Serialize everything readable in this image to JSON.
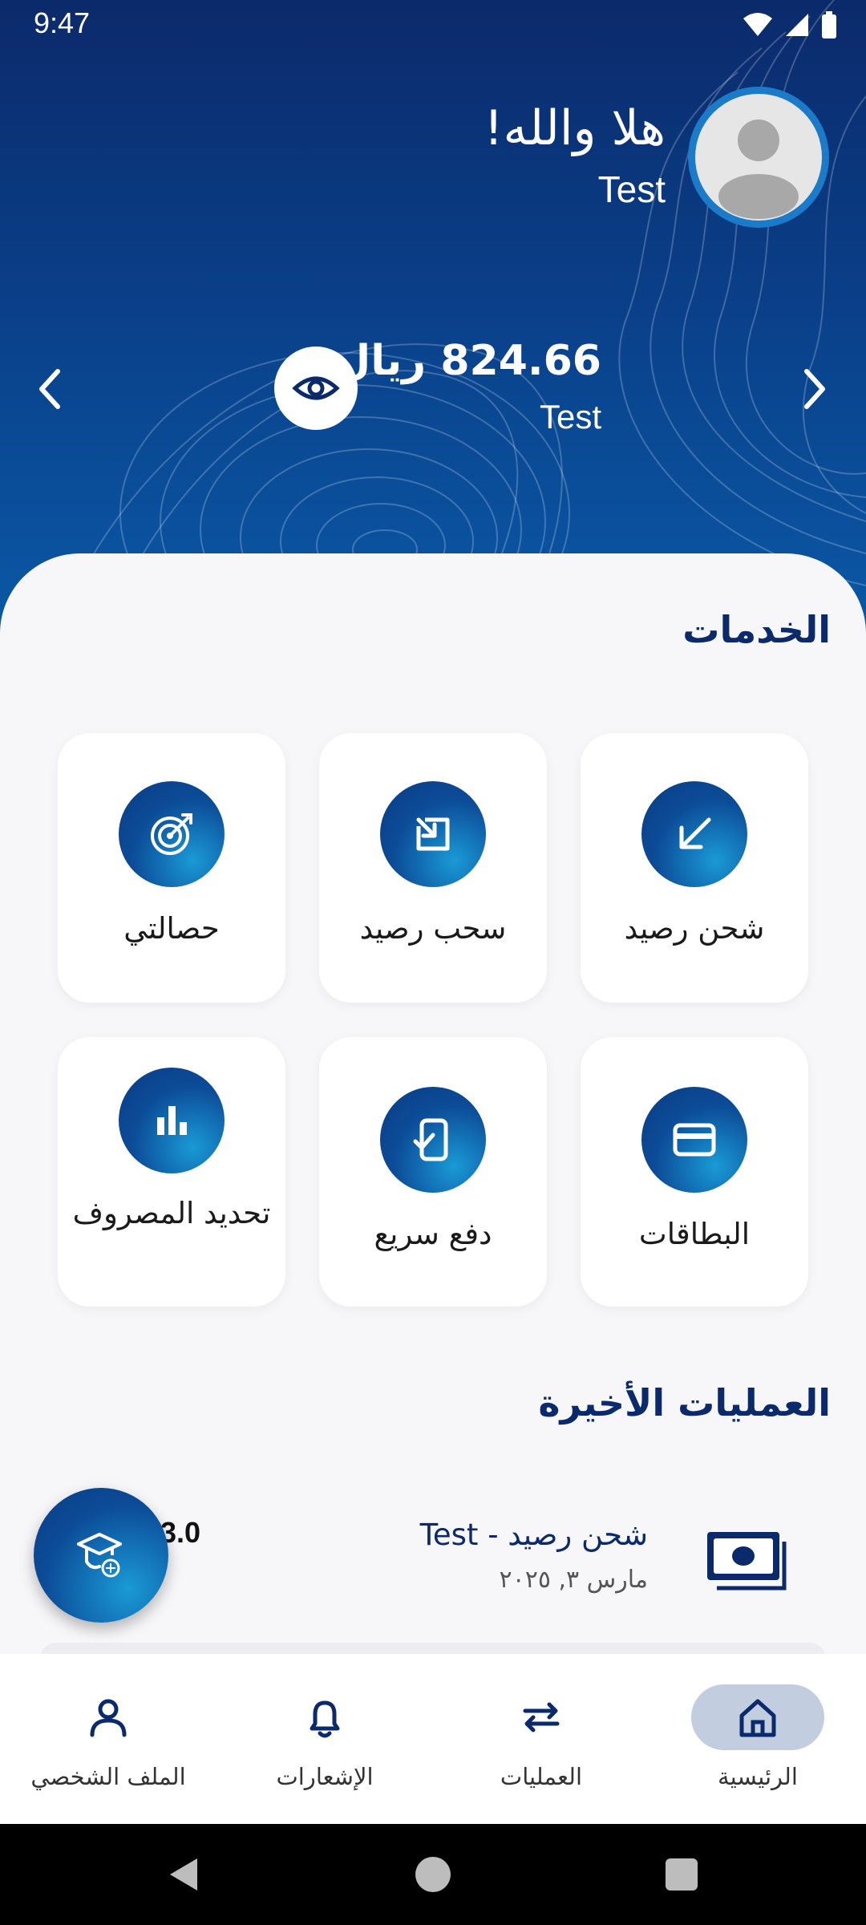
{
  "status_bar": {
    "time": "9:47"
  },
  "header": {
    "greeting": "هلا والله!",
    "user_name": "Test",
    "balance_amount": "824.66 ريال",
    "account_name": "Test"
  },
  "services": {
    "title": "الخدمات",
    "items": [
      {
        "label": "شحن رصيد",
        "icon": "arrow-down-left-icon"
      },
      {
        "label": "سحب رصيد",
        "icon": "arrow-up-right-box-icon"
      },
      {
        "label": "حصالتي",
        "icon": "target-icon"
      },
      {
        "label": "البطاقات",
        "icon": "credit-card-icon"
      },
      {
        "label": "دفع سريع",
        "icon": "phone-check-icon"
      },
      {
        "label": "تحديد المصروف",
        "icon": "bar-chart-icon"
      }
    ]
  },
  "recent": {
    "title": "العمليات الأخيرة",
    "transactions": [
      {
        "title": "شحن رصيد - Test",
        "date": "مارس ٣, ٢٠٢٥",
        "amount": "3.0"
      }
    ]
  },
  "bottom_nav": {
    "items": [
      {
        "label": "الرئيسية",
        "icon": "home-icon",
        "active": true
      },
      {
        "label": "العمليات",
        "icon": "transfer-arrows-icon",
        "active": false
      },
      {
        "label": "الإشعارات",
        "icon": "bell-icon",
        "active": false
      },
      {
        "label": "الملف الشخصي",
        "icon": "person-icon",
        "active": false
      }
    ]
  },
  "colors": {
    "primary": "#0b2a6b",
    "accent": "#1a9ad6",
    "background": "#f7f7fa",
    "nav_active": "#c3cde0"
  }
}
